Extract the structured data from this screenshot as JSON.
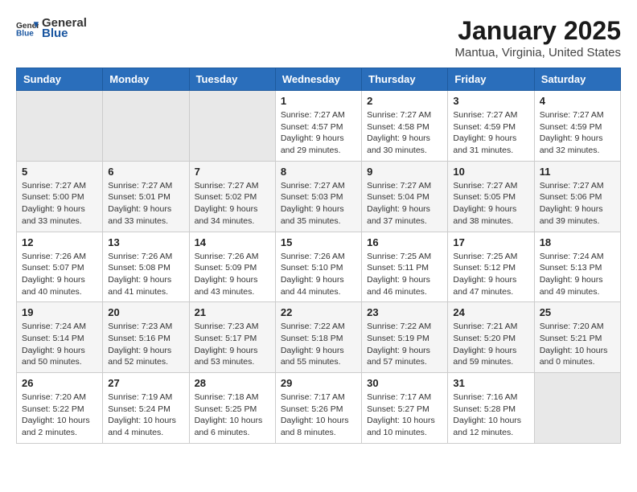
{
  "header": {
    "logo_general": "General",
    "logo_blue": "Blue",
    "month": "January 2025",
    "location": "Mantua, Virginia, United States"
  },
  "weekdays": [
    "Sunday",
    "Monday",
    "Tuesday",
    "Wednesday",
    "Thursday",
    "Friday",
    "Saturday"
  ],
  "weeks": [
    [
      {
        "day": "",
        "empty": true
      },
      {
        "day": "",
        "empty": true
      },
      {
        "day": "",
        "empty": true
      },
      {
        "day": "1",
        "sunrise": "7:27 AM",
        "sunset": "4:57 PM",
        "daylight": "9 hours and 29 minutes."
      },
      {
        "day": "2",
        "sunrise": "7:27 AM",
        "sunset": "4:58 PM",
        "daylight": "9 hours and 30 minutes."
      },
      {
        "day": "3",
        "sunrise": "7:27 AM",
        "sunset": "4:59 PM",
        "daylight": "9 hours and 31 minutes."
      },
      {
        "day": "4",
        "sunrise": "7:27 AM",
        "sunset": "4:59 PM",
        "daylight": "9 hours and 32 minutes."
      }
    ],
    [
      {
        "day": "5",
        "sunrise": "7:27 AM",
        "sunset": "5:00 PM",
        "daylight": "9 hours and 33 minutes."
      },
      {
        "day": "6",
        "sunrise": "7:27 AM",
        "sunset": "5:01 PM",
        "daylight": "9 hours and 33 minutes."
      },
      {
        "day": "7",
        "sunrise": "7:27 AM",
        "sunset": "5:02 PM",
        "daylight": "9 hours and 34 minutes."
      },
      {
        "day": "8",
        "sunrise": "7:27 AM",
        "sunset": "5:03 PM",
        "daylight": "9 hours and 35 minutes."
      },
      {
        "day": "9",
        "sunrise": "7:27 AM",
        "sunset": "5:04 PM",
        "daylight": "9 hours and 37 minutes."
      },
      {
        "day": "10",
        "sunrise": "7:27 AM",
        "sunset": "5:05 PM",
        "daylight": "9 hours and 38 minutes."
      },
      {
        "day": "11",
        "sunrise": "7:27 AM",
        "sunset": "5:06 PM",
        "daylight": "9 hours and 39 minutes."
      }
    ],
    [
      {
        "day": "12",
        "sunrise": "7:26 AM",
        "sunset": "5:07 PM",
        "daylight": "9 hours and 40 minutes."
      },
      {
        "day": "13",
        "sunrise": "7:26 AM",
        "sunset": "5:08 PM",
        "daylight": "9 hours and 41 minutes."
      },
      {
        "day": "14",
        "sunrise": "7:26 AM",
        "sunset": "5:09 PM",
        "daylight": "9 hours and 43 minutes."
      },
      {
        "day": "15",
        "sunrise": "7:26 AM",
        "sunset": "5:10 PM",
        "daylight": "9 hours and 44 minutes."
      },
      {
        "day": "16",
        "sunrise": "7:25 AM",
        "sunset": "5:11 PM",
        "daylight": "9 hours and 46 minutes."
      },
      {
        "day": "17",
        "sunrise": "7:25 AM",
        "sunset": "5:12 PM",
        "daylight": "9 hours and 47 minutes."
      },
      {
        "day": "18",
        "sunrise": "7:24 AM",
        "sunset": "5:13 PM",
        "daylight": "9 hours and 49 minutes."
      }
    ],
    [
      {
        "day": "19",
        "sunrise": "7:24 AM",
        "sunset": "5:14 PM",
        "daylight": "9 hours and 50 minutes."
      },
      {
        "day": "20",
        "sunrise": "7:23 AM",
        "sunset": "5:16 PM",
        "daylight": "9 hours and 52 minutes."
      },
      {
        "day": "21",
        "sunrise": "7:23 AM",
        "sunset": "5:17 PM",
        "daylight": "9 hours and 53 minutes."
      },
      {
        "day": "22",
        "sunrise": "7:22 AM",
        "sunset": "5:18 PM",
        "daylight": "9 hours and 55 minutes."
      },
      {
        "day": "23",
        "sunrise": "7:22 AM",
        "sunset": "5:19 PM",
        "daylight": "9 hours and 57 minutes."
      },
      {
        "day": "24",
        "sunrise": "7:21 AM",
        "sunset": "5:20 PM",
        "daylight": "9 hours and 59 minutes."
      },
      {
        "day": "25",
        "sunrise": "7:20 AM",
        "sunset": "5:21 PM",
        "daylight": "10 hours and 0 minutes."
      }
    ],
    [
      {
        "day": "26",
        "sunrise": "7:20 AM",
        "sunset": "5:22 PM",
        "daylight": "10 hours and 2 minutes."
      },
      {
        "day": "27",
        "sunrise": "7:19 AM",
        "sunset": "5:24 PM",
        "daylight": "10 hours and 4 minutes."
      },
      {
        "day": "28",
        "sunrise": "7:18 AM",
        "sunset": "5:25 PM",
        "daylight": "10 hours and 6 minutes."
      },
      {
        "day": "29",
        "sunrise": "7:17 AM",
        "sunset": "5:26 PM",
        "daylight": "10 hours and 8 minutes."
      },
      {
        "day": "30",
        "sunrise": "7:17 AM",
        "sunset": "5:27 PM",
        "daylight": "10 hours and 10 minutes."
      },
      {
        "day": "31",
        "sunrise": "7:16 AM",
        "sunset": "5:28 PM",
        "daylight": "10 hours and 12 minutes."
      },
      {
        "day": "",
        "empty": true
      }
    ]
  ]
}
